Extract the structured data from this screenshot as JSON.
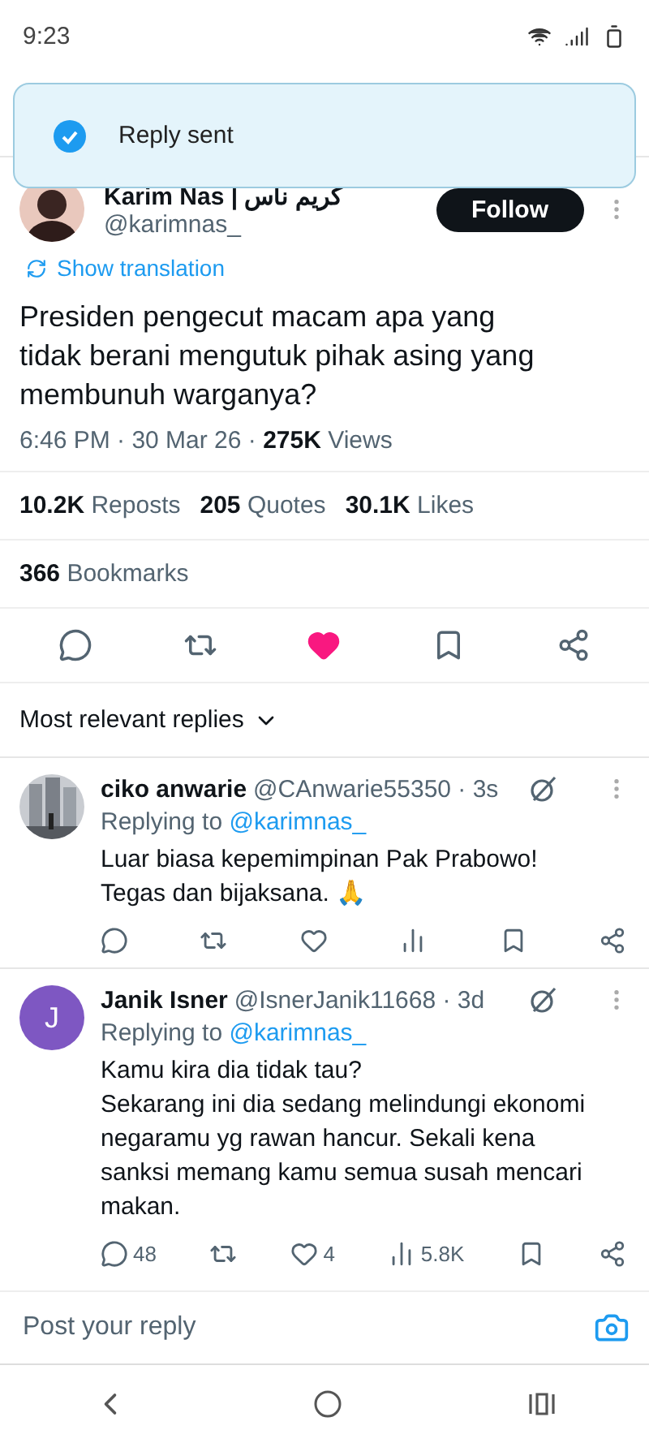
{
  "status_bar": {
    "time": "9:23"
  },
  "toast": {
    "message": "Reply sent"
  },
  "tweet": {
    "author": {
      "name": "Karim Nas | كريم ناس",
      "handle": "@karimnas_"
    },
    "follow_button": "Follow",
    "translate_link": "Show translation",
    "text": "Presiden pengecut macam apa yang tidak berani mengutuk pihak asing yang membunuh warganya?",
    "time": "6:46 PM · 30 Mar 26 · ",
    "views_count": "275K",
    "views_label": " Views",
    "stats": [
      {
        "count": "10.2K",
        "label": "Reposts"
      },
      {
        "count": "205",
        "label": "Quotes"
      },
      {
        "count": "30.1K",
        "label": "Likes"
      }
    ],
    "bookmarks": {
      "count": "366",
      "label": "Bookmarks"
    },
    "actions": [
      {
        "kind": "reply"
      },
      {
        "kind": "repost"
      },
      {
        "kind": "like",
        "selected": true
      },
      {
        "kind": "bookmark"
      },
      {
        "kind": "share"
      }
    ]
  },
  "replies_sort": "Most relevant replies",
  "replies": [
    {
      "name": "ciko anwarie",
      "handle": "@CAnwarie55350 · 3s",
      "replying_label": "Replying to ",
      "replying_to": "@karimnas_",
      "text": "Luar biasa kepemimpinan Pak Prabowo!\nTegas dan bijaksana. 🙏",
      "actions": [
        {
          "kind": "reply"
        },
        {
          "kind": "repost"
        },
        {
          "kind": "like"
        },
        {
          "kind": "views"
        },
        {
          "kind": "bookmark"
        },
        {
          "kind": "share"
        }
      ]
    },
    {
      "name": "Janik Isner",
      "handle": "@IsnerJanik11668 · 3d",
      "avatar": {
        "kind": "letter",
        "letter": "J",
        "color": "#7e57c2"
      },
      "replying_label": "Replying to ",
      "replying_to": "@karimnas_",
      "text": "Kamu kira dia tidak tau?\nSekarang ini dia sedang melindungi ekonomi negaramu yg rawan hancur. Sekali kena sanksi memang kamu semua susah mencari makan.",
      "actions": [
        {
          "kind": "reply",
          "count": "48"
        },
        {
          "kind": "repost"
        },
        {
          "kind": "like",
          "count": "4"
        },
        {
          "kind": "views",
          "count": "5.8K"
        },
        {
          "kind": "bookmark"
        },
        {
          "kind": "share"
        }
      ]
    }
  ],
  "reply_field": {
    "placeholder": "Post your reply"
  }
}
